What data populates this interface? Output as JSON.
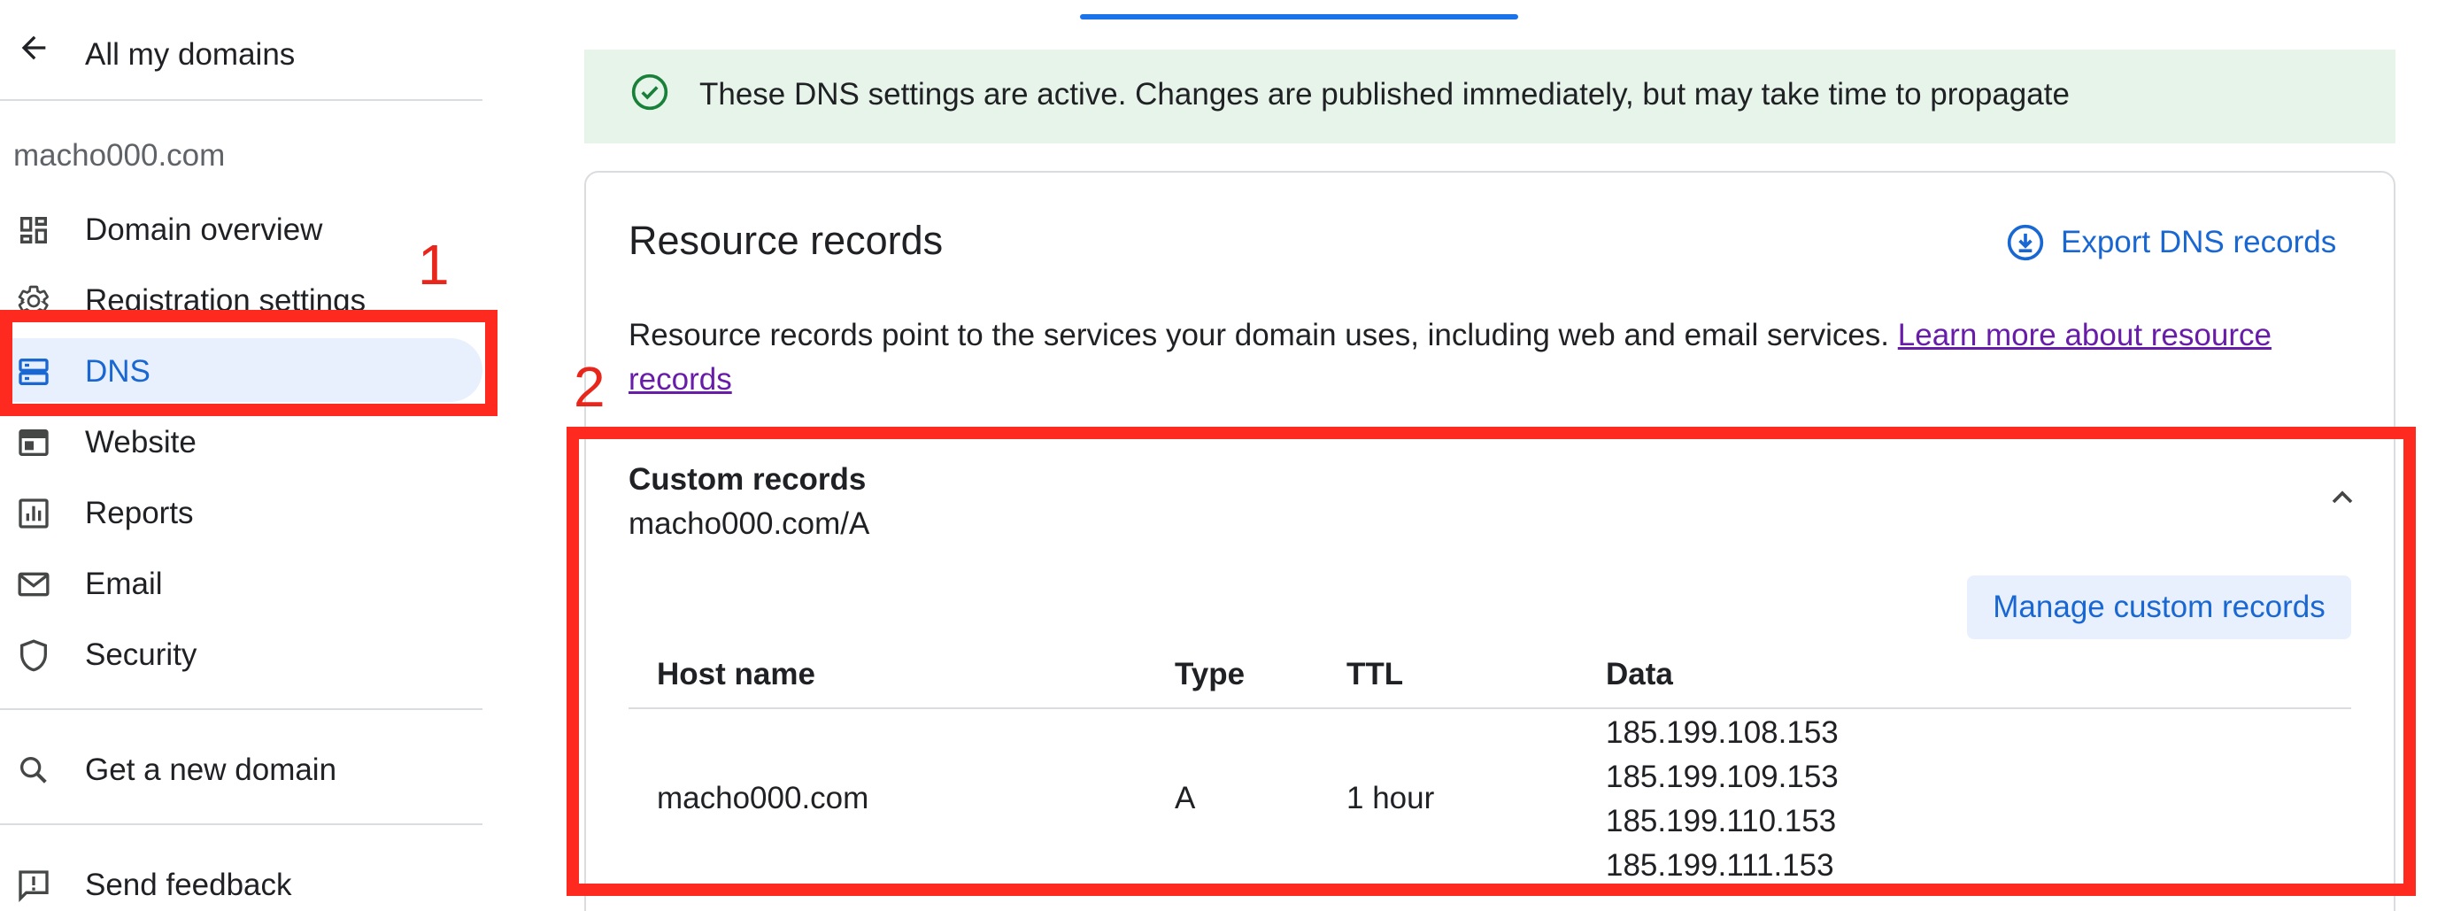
{
  "sidebar": {
    "back_label": "All my domains",
    "domain": "macho000.com",
    "items": [
      {
        "label": "Domain overview",
        "icon": "dashboard-icon"
      },
      {
        "label": "Registration settings",
        "icon": "gear-icon"
      },
      {
        "label": "DNS",
        "icon": "dns-icon",
        "active": true
      },
      {
        "label": "Website",
        "icon": "website-icon"
      },
      {
        "label": "Reports",
        "icon": "reports-icon"
      },
      {
        "label": "Email",
        "icon": "mail-icon"
      },
      {
        "label": "Security",
        "icon": "shield-icon"
      }
    ],
    "get_domain_label": "Get a new domain",
    "feedback_label": "Send feedback"
  },
  "banner": {
    "text": "These DNS settings are active. Changes are published immediately, but may take time to propagate"
  },
  "card": {
    "title": "Resource records",
    "export_label": "Export DNS records",
    "description": "Resource records point to the services your domain uses, including web and email services.",
    "learn_more_link": "Learn more about resource records"
  },
  "custom_records": {
    "title": "Custom records",
    "subtitle": "macho000.com/A",
    "manage_label": "Manage custom records",
    "columns": [
      "Host name",
      "Type",
      "TTL",
      "Data"
    ],
    "rows": [
      {
        "host": "macho000.com",
        "type": "A",
        "ttl": "1 hour",
        "data": [
          "185.199.108.153",
          "185.199.109.153",
          "185.199.110.153",
          "185.199.111.153"
        ]
      }
    ]
  },
  "annotations": [
    "1",
    "2"
  ],
  "colors": {
    "accent": "#1967d2",
    "active_bg": "#e8f0fe",
    "banner_bg": "#e6f4ea",
    "success": "#188038",
    "annotation": "#ff2a1f",
    "link_visited": "#681da8"
  }
}
